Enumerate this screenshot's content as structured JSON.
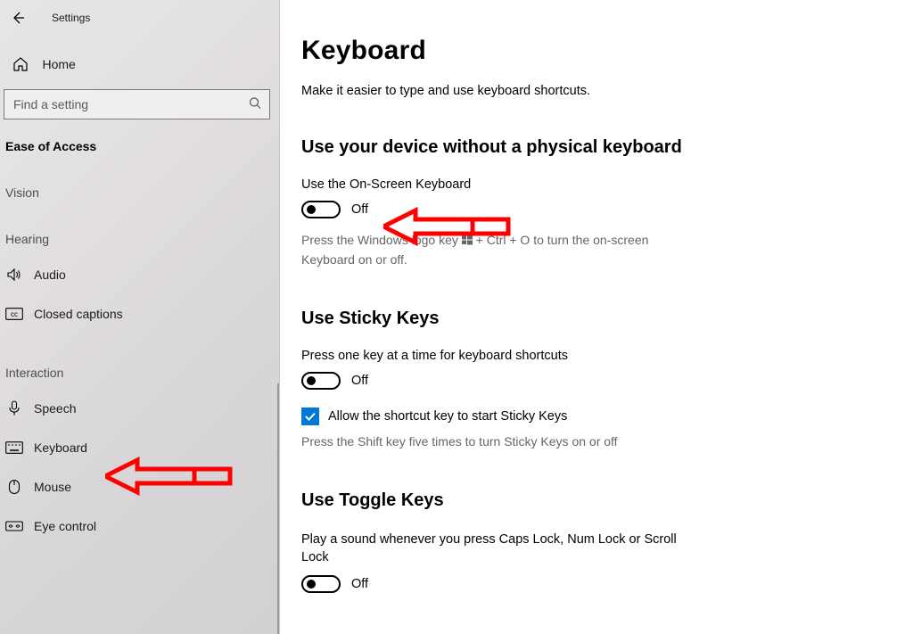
{
  "app": {
    "title": "Settings"
  },
  "sidebar": {
    "home": "Home",
    "search_placeholder": "Find a setting",
    "category": "Ease of Access",
    "groups": {
      "vision": "Vision",
      "hearing": "Hearing",
      "interaction": "Interaction"
    },
    "items": {
      "audio": "Audio",
      "closed_captions": "Closed captions",
      "speech": "Speech",
      "keyboard": "Keyboard",
      "mouse": "Mouse",
      "eye_control": "Eye control"
    }
  },
  "page": {
    "title": "Keyboard",
    "subtitle": "Make it easier to type and use keyboard shortcuts.",
    "osk": {
      "heading": "Use your device without a physical keyboard",
      "label": "Use the On-Screen Keyboard",
      "state": "Off",
      "hint_pre": "Press the Windows logo key ",
      "hint_post": " + Ctrl + O to turn the on-screen Keyboard on or off."
    },
    "sticky": {
      "heading": "Use Sticky Keys",
      "label": "Press one key at a time for keyboard shortcuts",
      "state": "Off",
      "shortcut_label": "Allow the shortcut key to start Sticky Keys",
      "shortcut_hint": "Press the Shift key five times to turn Sticky Keys on or off"
    },
    "toggle": {
      "heading": "Use Toggle Keys",
      "label": "Play a sound whenever you press Caps Lock, Num Lock or Scroll Lock",
      "state": "Off"
    }
  }
}
